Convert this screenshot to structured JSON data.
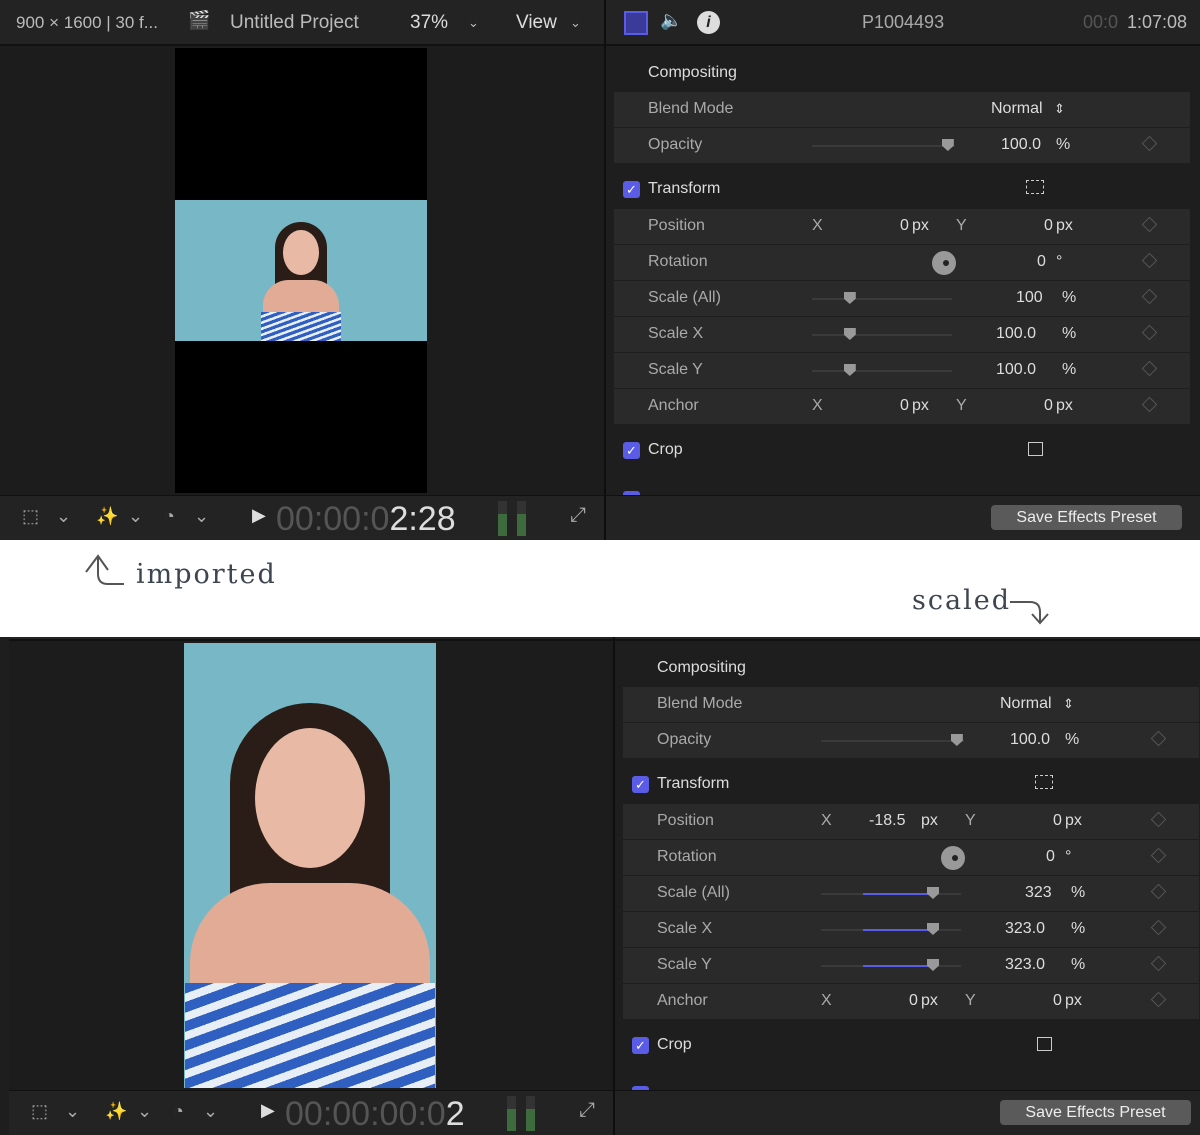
{
  "header": {
    "format": "900 × 1600 | 30 f...",
    "project": "Untitled Project",
    "zoom": "37%",
    "view": "View",
    "clip_name": "P1004493",
    "duration_dim": "00:0",
    "duration": "1:07:08"
  },
  "annotations": {
    "imported": "imported",
    "scaled": "scaled"
  },
  "colors": {
    "accent": "#5a5ce6",
    "video_bg": "#78b8c6"
  },
  "panels": [
    {
      "timecode_dim": "00:00:0",
      "timecode": "2:28",
      "video_mode": "letterboxed",
      "save_button": "Save Effects Preset",
      "compositing": {
        "title": "Compositing",
        "blend_label": "Blend Mode",
        "blend_value": "Normal",
        "opacity_label": "Opacity",
        "opacity_value": "100.0",
        "opacity_unit": "%",
        "opacity_level": 0.95
      },
      "transform": {
        "title": "Transform",
        "checked": true,
        "position": {
          "label": "Position",
          "x": "0",
          "y": "0",
          "unit": "px"
        },
        "rotation": {
          "label": "Rotation",
          "value": "0",
          "unit": "°"
        },
        "scale_all": {
          "label": "Scale (All)",
          "value": "100",
          "unit": "%",
          "level": 0.27
        },
        "scale_x": {
          "label": "Scale X",
          "value": "100.0",
          "unit": "%",
          "level": 0.27
        },
        "scale_y": {
          "label": "Scale Y",
          "value": "100.0",
          "unit": "%",
          "level": 0.27
        },
        "anchor": {
          "label": "Anchor",
          "x": "0",
          "y": "0",
          "unit": "px"
        }
      },
      "crop": {
        "title": "Crop",
        "checked": true
      }
    },
    {
      "timecode_dim": "00:00:00:0",
      "timecode": "2",
      "video_mode": "filled",
      "save_button": "Save Effects Preset",
      "compositing": {
        "title": "Compositing",
        "blend_label": "Blend Mode",
        "blend_value": "Normal",
        "opacity_label": "Opacity",
        "opacity_value": "100.0",
        "opacity_unit": "%",
        "opacity_level": 0.95
      },
      "transform": {
        "title": "Transform",
        "checked": true,
        "position": {
          "label": "Position",
          "x": "-18.5",
          "y": "0",
          "unit": "px"
        },
        "rotation": {
          "label": "Rotation",
          "value": "0",
          "unit": "°"
        },
        "scale_all": {
          "label": "Scale (All)",
          "value": "323",
          "unit": "%",
          "level": 0.8
        },
        "scale_x": {
          "label": "Scale X",
          "value": "323.0",
          "unit": "%",
          "level": 0.8
        },
        "scale_y": {
          "label": "Scale Y",
          "value": "323.0",
          "unit": "%",
          "level": 0.8
        },
        "anchor": {
          "label": "Anchor",
          "x": "0",
          "y": "0",
          "unit": "px"
        }
      },
      "crop": {
        "title": "Crop",
        "checked": true
      }
    }
  ]
}
